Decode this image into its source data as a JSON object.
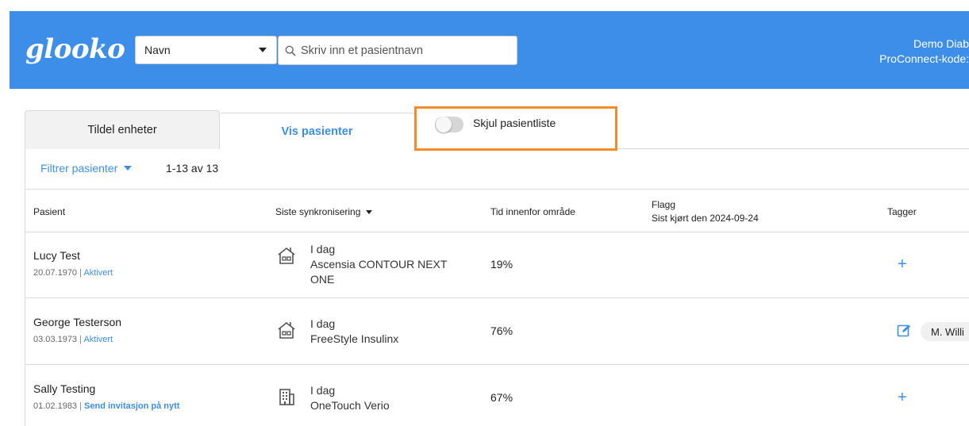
{
  "header": {
    "logo_text": "glooko",
    "search_type": {
      "selected": "Navn"
    },
    "search": {
      "placeholder": "Skriv inn et pasientnavn"
    },
    "account": {
      "line1": "Demo Diab",
      "line2": "ProConnect-kode:"
    },
    "colors": {
      "brand": "#3d8ee9"
    }
  },
  "tabs": [
    {
      "label": "Tildel enheter",
      "active": false
    },
    {
      "label": "Vis pasienter",
      "active": true
    }
  ],
  "toggle": {
    "label": "Skjul pasientliste",
    "on": false,
    "highlight_color": "#f58c2b"
  },
  "filter": {
    "label": "Filtrer pasienter",
    "count": "1-13 av 13"
  },
  "table": {
    "columns": {
      "patient": "Pasient",
      "last_sync": "Siste synkronisering",
      "tir": "Tid innenfor område",
      "flags": "Flagg",
      "flags_sub": "Sist kjørt den 2024-09-24",
      "tags": "Tagger"
    },
    "rows": [
      {
        "name": "Lucy Test",
        "dob": "20.07.1970",
        "status": "Aktivert",
        "sync_icon": "home-sync-icon",
        "sync_when": "I dag",
        "sync_device": "Ascensia CONTOUR NEXT ONE",
        "tir": "19%",
        "tags_action": "+"
      },
      {
        "name": "George Testerson",
        "dob": "03.03.1973",
        "status": "Aktivert",
        "sync_icon": "home-sync-icon",
        "sync_when": "I dag",
        "sync_device": "FreeStyle Insulinx",
        "tir": "76%",
        "tag": "M. Willi"
      },
      {
        "name": "Sally Testing",
        "dob": "01.02.1983",
        "status": "Send invitasjon på nytt",
        "sync_icon": "clinic-sync-icon",
        "sync_when": "I dag",
        "sync_device": "OneTouch Verio",
        "tir": "67%",
        "tags_action": "+"
      }
    ]
  }
}
